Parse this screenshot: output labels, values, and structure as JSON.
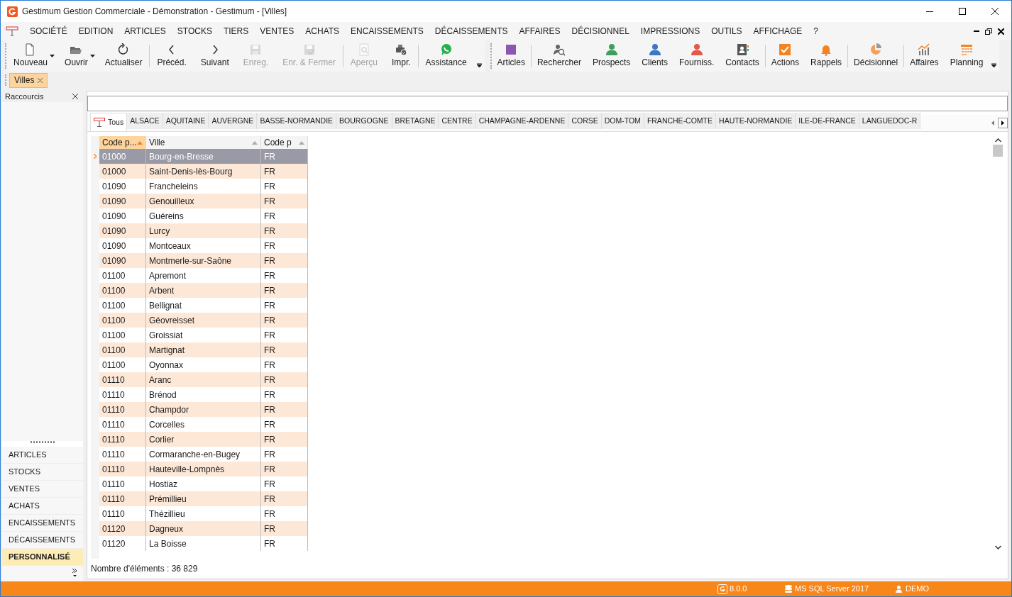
{
  "window": {
    "title": "Gestimum Gestion Commerciale - Démonstration - Gestimum - [Villes]"
  },
  "menu": [
    "SOCIÉTÉ",
    "EDITION",
    "ARTICLES",
    "STOCKS",
    "TIERS",
    "VENTES",
    "ACHATS",
    "ENCAISSEMENTS",
    "DÉCAISSEMENTS",
    "AFFAIRES",
    "DÉCISIONNEL",
    "IMPRESSIONS",
    "OUTILS",
    "AFFICHAGE",
    "?"
  ],
  "toolbar": [
    {
      "label": "Nouveau",
      "disabled": false,
      "dropdown": true
    },
    {
      "label": "Ouvrir",
      "disabled": false,
      "dropdown": true
    },
    {
      "label": "Actualiser",
      "disabled": false,
      "dropdown": false
    },
    {
      "label": "Précéd.",
      "disabled": false,
      "dropdown": false
    },
    {
      "label": "Suivant",
      "disabled": false,
      "dropdown": false
    },
    {
      "label": "Enreg.",
      "disabled": true,
      "dropdown": false
    },
    {
      "label": "Enr. & Fermer",
      "disabled": true,
      "dropdown": false
    },
    {
      "label": "Aperçu",
      "disabled": true,
      "dropdown": false
    },
    {
      "label": "Impr.",
      "disabled": false,
      "dropdown": false
    },
    {
      "label": "Assistance",
      "disabled": false,
      "dropdown": false
    }
  ],
  "toolbar_2": [
    {
      "label": "Articles"
    },
    {
      "label": "Rechercher"
    },
    {
      "label": "Prospects"
    },
    {
      "label": "Clients"
    },
    {
      "label": "Fourniss."
    },
    {
      "label": "Contacts"
    },
    {
      "label": "Actions"
    },
    {
      "label": "Rappels"
    },
    {
      "label": "Décisionnel"
    },
    {
      "label": "Affaires"
    },
    {
      "label": "Planning"
    }
  ],
  "document_tabs": [
    {
      "label": "Villes",
      "selected": true
    }
  ],
  "sidebar": {
    "title": "Raccourcis",
    "items": [
      {
        "label": "ARTICLES",
        "selected": false
      },
      {
        "label": "STOCKS",
        "selected": false
      },
      {
        "label": "VENTES",
        "selected": false
      },
      {
        "label": "ACHATS",
        "selected": false
      },
      {
        "label": "ENCAISSEMENTS",
        "selected": false
      },
      {
        "label": "DÉCAISSEMENTS",
        "selected": false
      },
      {
        "label": "PERSONNALISÉ",
        "selected": true
      }
    ]
  },
  "region_tabs": [
    {
      "label": "Tous",
      "selected": true
    },
    {
      "label": "ALSACE",
      "selected": false
    },
    {
      "label": "AQUITAINE",
      "selected": false
    },
    {
      "label": "AUVERGNE",
      "selected": false
    },
    {
      "label": "BASSE-NORMANDIE",
      "selected": false
    },
    {
      "label": "BOURGOGNE",
      "selected": false
    },
    {
      "label": "BRETAGNE",
      "selected": false
    },
    {
      "label": "CENTRE",
      "selected": false
    },
    {
      "label": "CHAMPAGNE-ARDENNE",
      "selected": false
    },
    {
      "label": "CORSE",
      "selected": false
    },
    {
      "label": "DOM-TOM",
      "selected": false
    },
    {
      "label": "FRANCHE-COMTE",
      "selected": false
    },
    {
      "label": "HAUTE-NORMANDIE",
      "selected": false
    },
    {
      "label": "ILE-DE-FRANCE",
      "selected": false
    },
    {
      "label": "LANGUEDOC-R",
      "selected": false
    }
  ],
  "table": {
    "columns": [
      {
        "label": "Code p...",
        "sorted": true
      },
      {
        "label": "Ville",
        "sorted": false
      },
      {
        "label": "Code p",
        "sorted": false
      }
    ],
    "rows": [
      {
        "cells": [
          "01000",
          "Bourg-en-Bresse",
          "FR"
        ],
        "selected": true
      },
      {
        "cells": [
          "01000",
          "Saint-Denis-lès-Bourg",
          "FR"
        ],
        "selected": false
      },
      {
        "cells": [
          "01090",
          "Francheleins",
          "FR"
        ],
        "selected": false
      },
      {
        "cells": [
          "01090",
          "Genouilleux",
          "FR"
        ],
        "selected": false
      },
      {
        "cells": [
          "01090",
          "Guéreins",
          "FR"
        ],
        "selected": false
      },
      {
        "cells": [
          "01090",
          "Lurcy",
          "FR"
        ],
        "selected": false
      },
      {
        "cells": [
          "01090",
          "Montceaux",
          "FR"
        ],
        "selected": false
      },
      {
        "cells": [
          "01090",
          "Montmerle-sur-Saône",
          "FR"
        ],
        "selected": false
      },
      {
        "cells": [
          "01100",
          "Apremont",
          "FR"
        ],
        "selected": false
      },
      {
        "cells": [
          "01100",
          "Arbent",
          "FR"
        ],
        "selected": false
      },
      {
        "cells": [
          "01100",
          "Bellignat",
          "FR"
        ],
        "selected": false
      },
      {
        "cells": [
          "01100",
          "Géovreisset",
          "FR"
        ],
        "selected": false
      },
      {
        "cells": [
          "01100",
          "Groissiat",
          "FR"
        ],
        "selected": false
      },
      {
        "cells": [
          "01100",
          "Martignat",
          "FR"
        ],
        "selected": false
      },
      {
        "cells": [
          "01100",
          "Oyonnax",
          "FR"
        ],
        "selected": false
      },
      {
        "cells": [
          "01110",
          "Aranc",
          "FR"
        ],
        "selected": false
      },
      {
        "cells": [
          "01110",
          "Brénod",
          "FR"
        ],
        "selected": false
      },
      {
        "cells": [
          "01110",
          "Champdor",
          "FR"
        ],
        "selected": false
      },
      {
        "cells": [
          "01110",
          "Corcelles",
          "FR"
        ],
        "selected": false
      },
      {
        "cells": [
          "01110",
          "Corlier",
          "FR"
        ],
        "selected": false
      },
      {
        "cells": [
          "01110",
          "Cormaranche-en-Bugey",
          "FR"
        ],
        "selected": false
      },
      {
        "cells": [
          "01110",
          "Hauteville-Lompnès",
          "FR"
        ],
        "selected": false
      },
      {
        "cells": [
          "01110",
          "Hostiaz",
          "FR"
        ],
        "selected": false
      },
      {
        "cells": [
          "01110",
          "Prémillieu",
          "FR"
        ],
        "selected": false
      },
      {
        "cells": [
          "01110",
          "Thézillieu",
          "FR"
        ],
        "selected": false
      },
      {
        "cells": [
          "01120",
          "Dagneux",
          "FR"
        ],
        "selected": false
      },
      {
        "cells": [
          "01120",
          "La Boisse",
          "FR"
        ],
        "selected": false
      }
    ]
  },
  "footer": "Nombre d'éléments : 36 829",
  "status_bar": {
    "version": "8.0.0",
    "database": "MS SQL Server 2017",
    "user": "DEMO"
  }
}
